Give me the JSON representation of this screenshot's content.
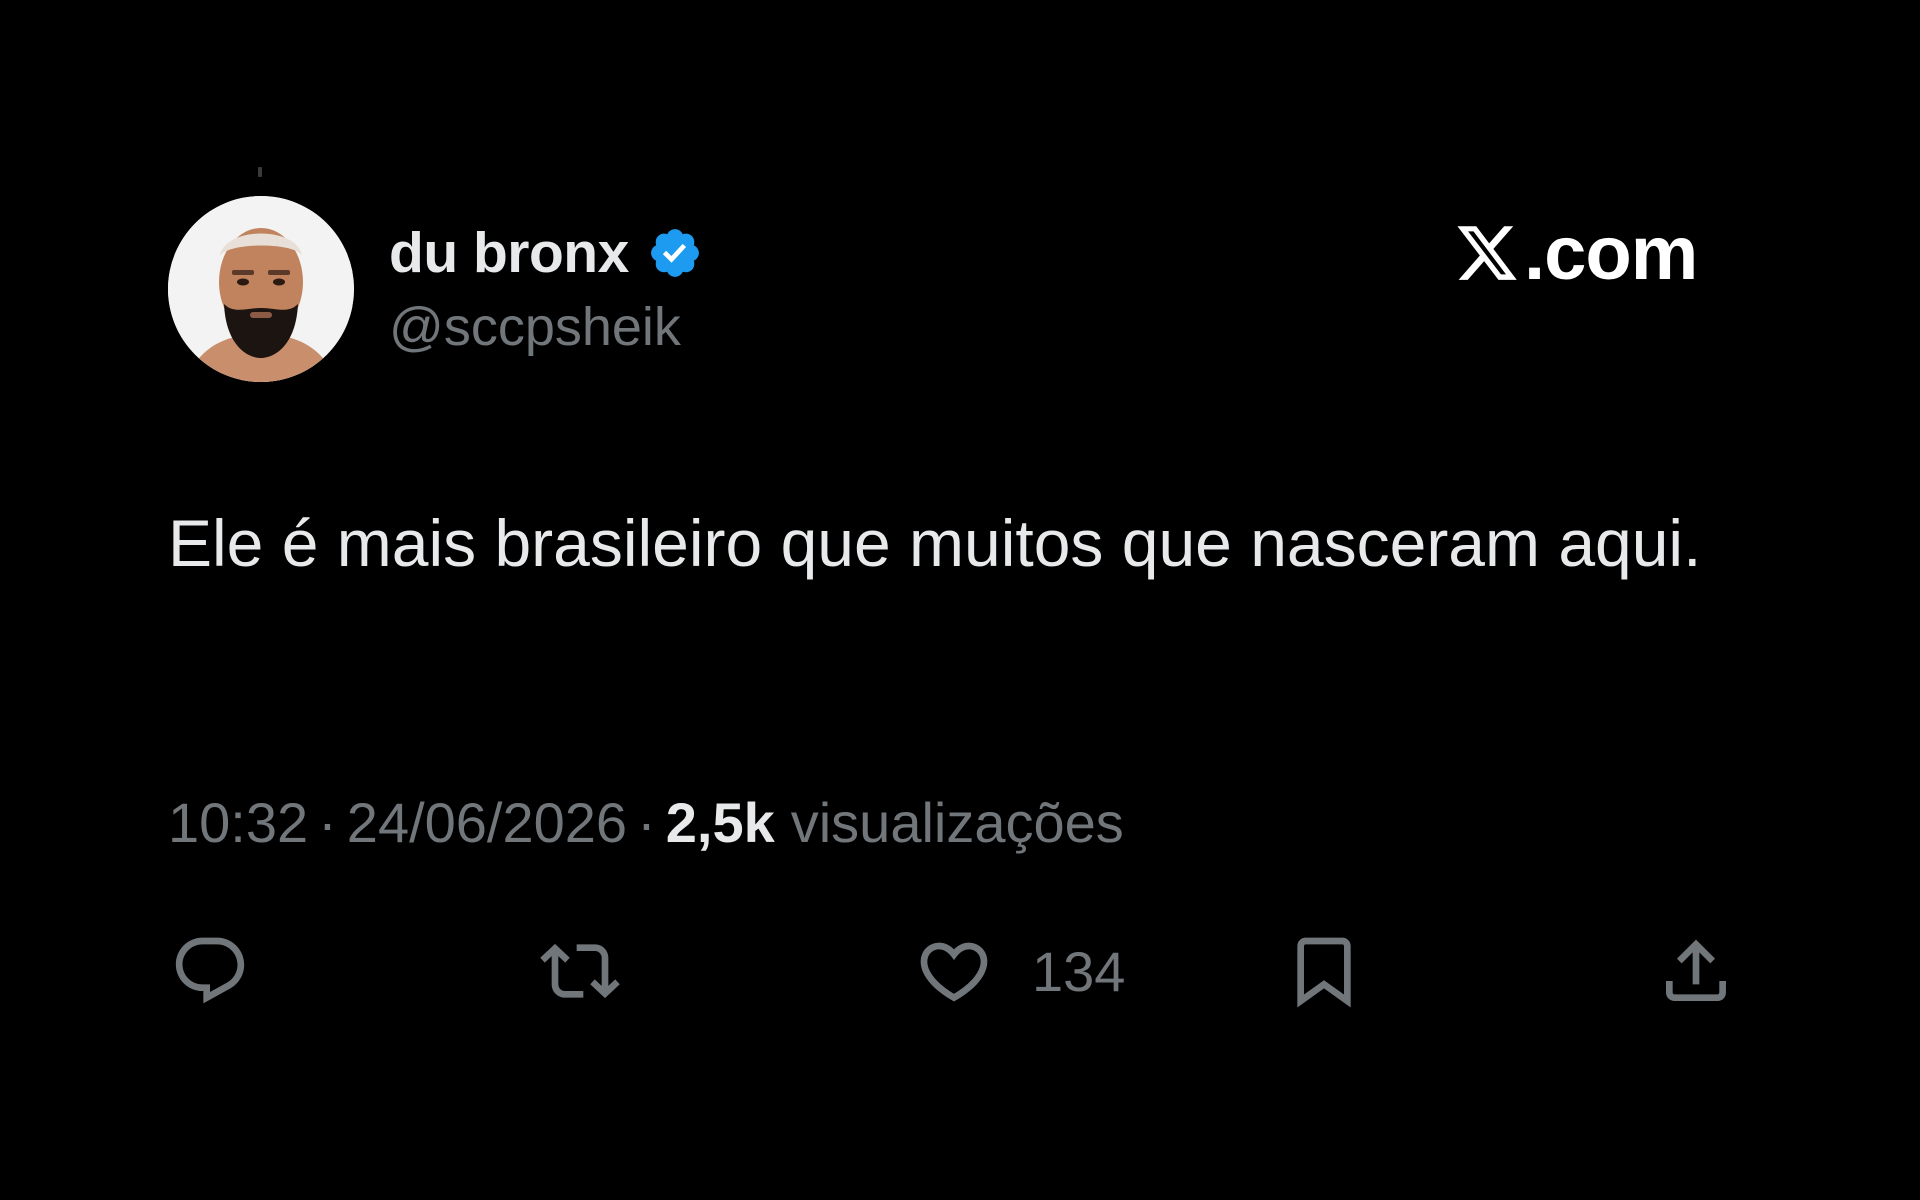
{
  "author": {
    "display_name": "du bronx",
    "handle": "@sccpsheik",
    "verified": true,
    "verified_color": "#1d9bf0",
    "avatar_icon": "user-avatar"
  },
  "brand": {
    "logo": "x-logo-icon",
    "suffix": ".com"
  },
  "tweet": {
    "text": "Ele é mais brasileiro que muitos que nasceram aqui."
  },
  "meta": {
    "time": "10:32",
    "separator": "·",
    "date": "24/06/2026",
    "views_count": "2,5k",
    "views_label": "visualizações"
  },
  "actions": {
    "reply_icon": "reply-icon",
    "retweet_icon": "retweet-icon",
    "like_icon": "heart-icon",
    "like_count": "134",
    "bookmark_icon": "bookmark-icon",
    "share_icon": "share-icon"
  },
  "colors": {
    "background": "#000000",
    "primary_text": "#e7e9ea",
    "secondary_text": "#71767b"
  }
}
